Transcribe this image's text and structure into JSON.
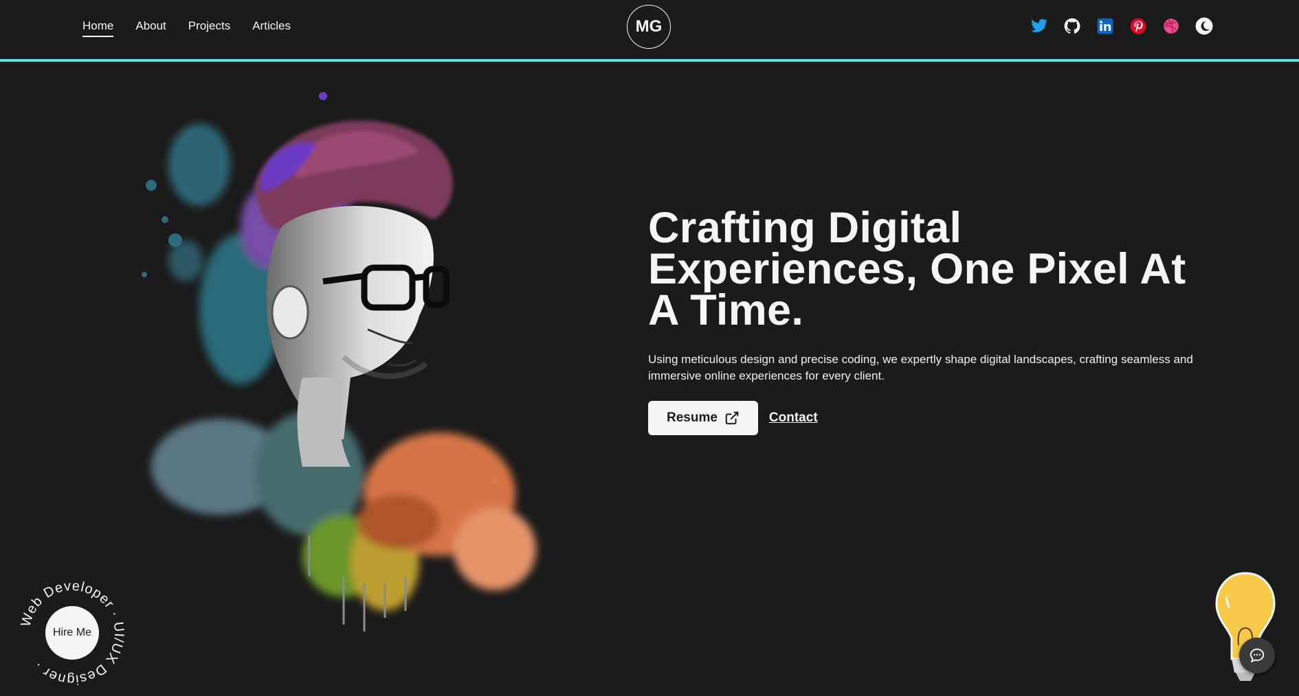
{
  "nav": {
    "items": [
      {
        "label": "Home",
        "active": true
      },
      {
        "label": "About",
        "active": false
      },
      {
        "label": "Projects",
        "active": false
      },
      {
        "label": "Articles",
        "active": false
      }
    ]
  },
  "logo": {
    "text": "MG"
  },
  "social": [
    {
      "icon": "twitter-icon",
      "color": "#1da1f2"
    },
    {
      "icon": "github-icon",
      "color": "#f5f5f5"
    },
    {
      "icon": "linkedin-icon",
      "color": "#0a66c2"
    },
    {
      "icon": "pinterest-icon",
      "color": "#e60023"
    },
    {
      "icon": "dribbble-icon",
      "color": "#ea4c89"
    },
    {
      "icon": "theme-toggle-icon",
      "color": "#f5f5f5"
    }
  ],
  "hero": {
    "title": "Crafting Digital Experiences, One Pixel At A Time.",
    "description": "Using meticulous design and precise coding, we expertly shape digital landscapes, crafting seamless and immersive online experiences for every client.",
    "resume_label": "Resume",
    "contact_label": "Contact"
  },
  "hire": {
    "button_label": "Hire Me",
    "ring_text": "Web Developer · UI/UX Designer ·"
  },
  "colors": {
    "background": "#1b1b1b",
    "accent_line": "#58e6d9",
    "text": "#f5f5f5"
  }
}
